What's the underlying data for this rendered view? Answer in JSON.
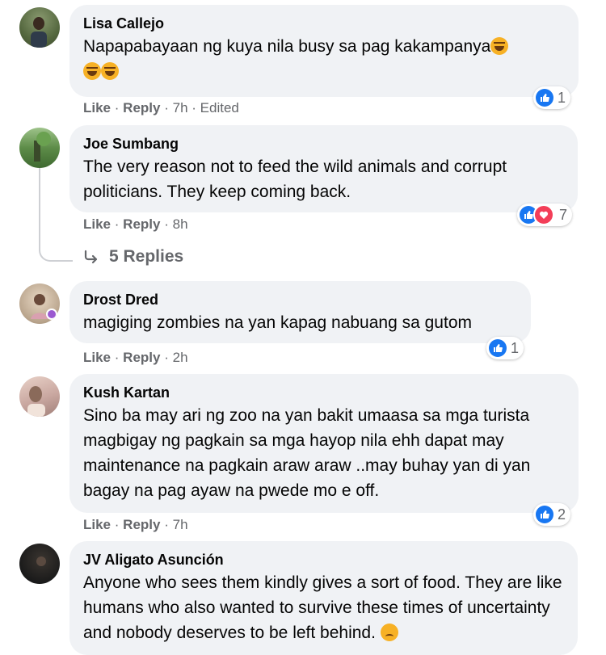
{
  "comments": [
    {
      "author": "Lisa Callejo",
      "text_line1": "Napapabayaan ng kuya nila busy sa pag kakampanya",
      "like": "Like",
      "reply": "Reply",
      "time": "7h",
      "edited": "Edited",
      "reaction_count": "1",
      "colors": {
        "avatar": "#6b7a5a"
      }
    },
    {
      "author": "Joe Sumbang",
      "text": "The very reason not to feed the wild animals and corrupt politicians. They keep coming back.",
      "like": "Like",
      "reply": "Reply",
      "time": "8h",
      "reaction_count": "7",
      "replies_label": "5 Replies",
      "colors": {
        "avatar": "#4e7a3a"
      }
    },
    {
      "author": "Drost Dred",
      "text": "magiging zombies na yan kapag nabuang sa gutom",
      "like": "Like",
      "reply": "Reply",
      "time": "2h",
      "reaction_count": "1",
      "colors": {
        "avatar": "#b9a48c"
      }
    },
    {
      "author": "Kush Kartan",
      "text": "Sino ba may ari ng zoo na yan bakit umaasa sa mga turista magbigay ng pagkain sa mga hayop nila ehh dapat may maintenance na pagkain araw araw ..may buhay yan di yan bagay na pag ayaw na pwede mo e off.",
      "like": "Like",
      "reply": "Reply",
      "time": "7h",
      "reaction_count": "2",
      "colors": {
        "avatar": "#c9a7a0"
      }
    },
    {
      "author": "JV Aligato Asunción",
      "text": "Anyone who sees them kindly gives a sort of food. They are like humans who also wanted to survive these times of uncertainty and nobody deserves to be left behind.",
      "colors": {
        "avatar": "#1a1a1a"
      }
    }
  ],
  "icons": {
    "like": "like-icon",
    "heart": "heart-icon",
    "laugh": "laughing-emoji",
    "cry": "crying-emoji",
    "reply_arrow": "reply-arrow-icon"
  },
  "colors": {
    "bubble": "#f0f2f5",
    "like_blue": "#1877f2",
    "heart_red": "#f33e58",
    "meta_gray": "#65676b"
  },
  "separator": "·"
}
